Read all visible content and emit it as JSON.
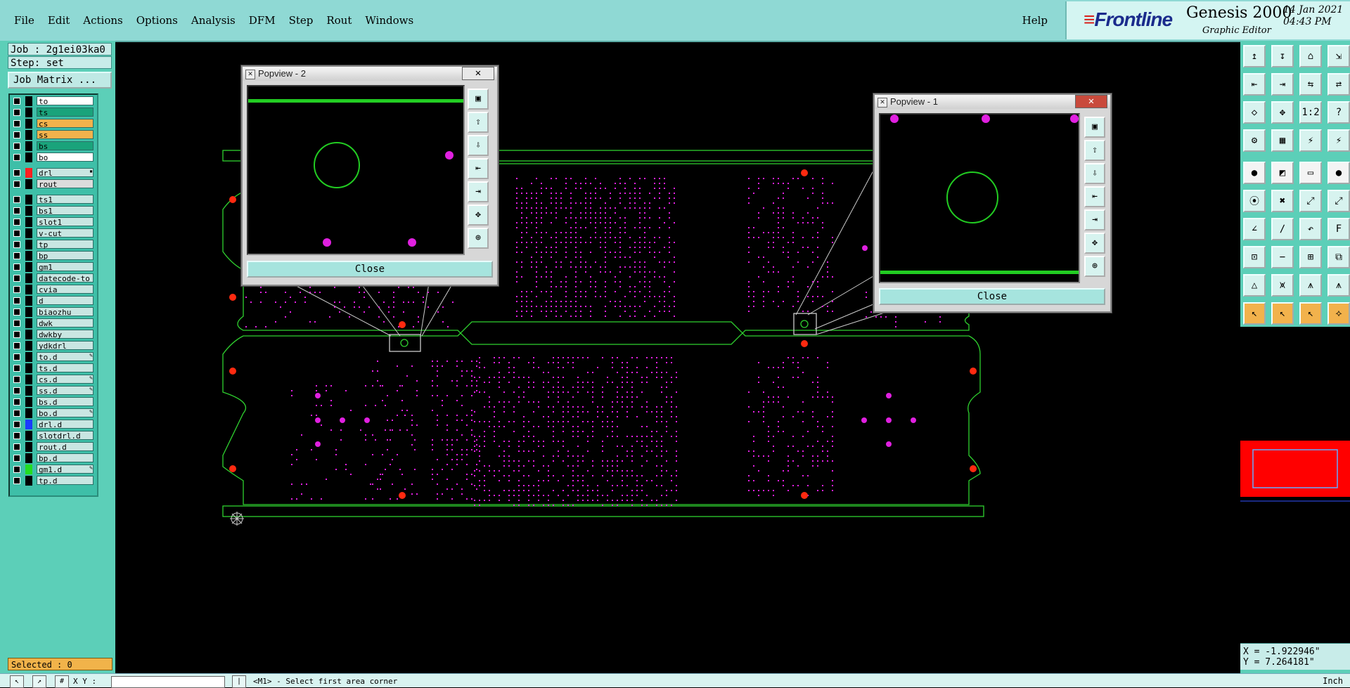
{
  "menubar": {
    "items": [
      "File",
      "Edit",
      "Actions",
      "Options",
      "Analysis",
      "DFM",
      "Step",
      "Rout",
      "Windows"
    ],
    "help": "Help",
    "brand": {
      "logo": "Frontline",
      "product": "Genesis 2000",
      "subtitle": "Graphic Editor",
      "date": "14 Jan 2021",
      "time": "04:43 PM"
    }
  },
  "job": {
    "job_label": "Job : 2g1ei03ka0",
    "step_label": "Step: set",
    "matrix_button": "Job Matrix ..."
  },
  "layers": [
    {
      "name": "to",
      "color": "#ffffff"
    },
    {
      "name": "ts",
      "color": "#1aa37b"
    },
    {
      "name": "cs",
      "color": "#f2b24c"
    },
    {
      "name": "ss",
      "color": "#f2b24c"
    },
    {
      "name": "bs",
      "color": "#1aa37b"
    },
    {
      "name": "bo",
      "color": "#ffffff"
    },
    {
      "name": "drl",
      "color": "#c9e6e2",
      "swatch": "#ff2020",
      "mark": "▪"
    },
    {
      "name": "rout",
      "color": "#dcdcdc"
    },
    {
      "name": "ts1",
      "color": "#c9e6e2"
    },
    {
      "name": "bs1",
      "color": "#c9e6e2"
    },
    {
      "name": "slot1",
      "color": "#c9e6e2"
    },
    {
      "name": "v-cut",
      "color": "#c9e6e2"
    },
    {
      "name": "tp",
      "color": "#c9e6e2"
    },
    {
      "name": "bp",
      "color": "#c9e6e2"
    },
    {
      "name": "gm1",
      "color": "#c9e6e2"
    },
    {
      "name": "datecode-to",
      "color": "#c9e6e2"
    },
    {
      "name": "cvia",
      "color": "#c9e6e2"
    },
    {
      "name": "d",
      "color": "#c9e6e2"
    },
    {
      "name": "biaozhu",
      "color": "#c9e6e2"
    },
    {
      "name": "dwk",
      "color": "#c9e6e2"
    },
    {
      "name": "dwkby",
      "color": "#c9e6e2"
    },
    {
      "name": "ydkdrl",
      "color": "#c9e6e2"
    },
    {
      "name": "to.d",
      "color": "#c9e6e2",
      "mark": "✎"
    },
    {
      "name": "ts.d",
      "color": "#c9e6e2"
    },
    {
      "name": "cs.d",
      "color": "#c9e6e2",
      "mark": "✎"
    },
    {
      "name": "ss.d",
      "color": "#c9e6e2",
      "mark": "✎"
    },
    {
      "name": "bs.d",
      "color": "#c9e6e2"
    },
    {
      "name": "bo.d",
      "color": "#c9e6e2",
      "mark": "✎"
    },
    {
      "name": "drl.d",
      "color": "#c9e6e2",
      "swatch": "#1a3cff"
    },
    {
      "name": "slotdrl.d",
      "color": "#c9e6e2"
    },
    {
      "name": "rout.d",
      "color": "#c9e6e2"
    },
    {
      "name": "bp.d",
      "color": "#c9e6e2"
    },
    {
      "name": "gm1.d",
      "color": "#c9e6e2",
      "swatch": "#22dd22",
      "mark": "✎"
    },
    {
      "name": "tp.d",
      "color": "#c9e6e2"
    }
  ],
  "selected": "Selected : 0",
  "popview2": {
    "title": "Popview - 2",
    "close": "Close"
  },
  "popview1": {
    "title": "Popview - 1",
    "close": "Close"
  },
  "coords": {
    "x": "X = -1.922946\"",
    "y": "Y = 7.264181\""
  },
  "statusbar": {
    "xy_label": "X Y :",
    "message": "<M1> - Select first area corner",
    "unit": "Inch"
  },
  "colors": {
    "board": "#2fd12f",
    "pads": "#e020e0",
    "drills": "#ff2a10",
    "panel_bg": "#5ccfb8"
  }
}
